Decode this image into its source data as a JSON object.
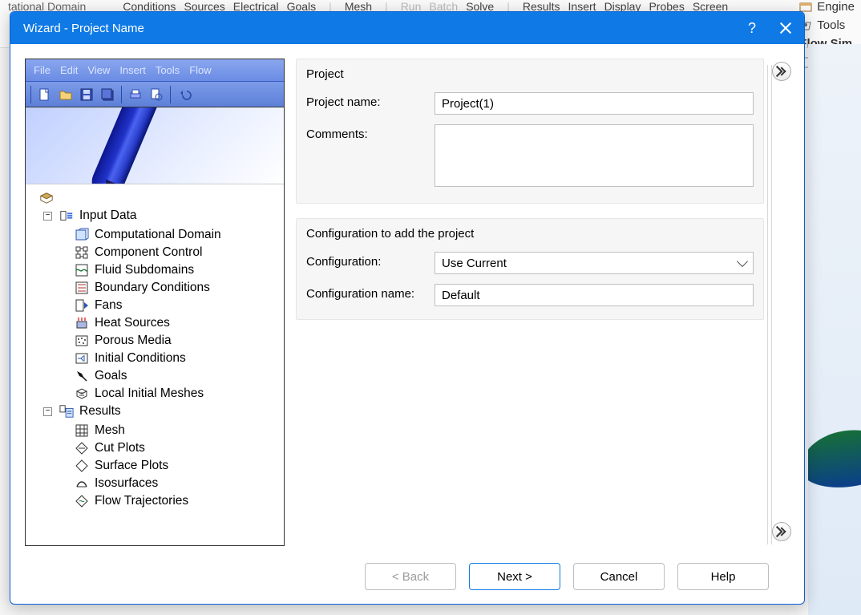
{
  "background": {
    "ribbon_items": [
      "Conditions",
      "Sources",
      "Electrical",
      "Goals",
      "Mesh",
      "Run",
      "Batch",
      "Solve",
      "Results",
      "Insert",
      "Display",
      "Probes",
      "Screen"
    ],
    "left_cut_text": "tational Domain",
    "right_items": [
      "Engine",
      "Tools",
      "Flow Sim"
    ]
  },
  "dialog": {
    "title": "Wizard - Project Name"
  },
  "left": {
    "menus": [
      "File",
      "Edit",
      "View",
      "Insert",
      "Tools",
      "Flow"
    ],
    "root_label": "",
    "tree": {
      "input_data": "Input Data",
      "children_input": [
        "Computational Domain",
        "Component Control",
        "Fluid Subdomains",
        "Boundary Conditions",
        "Fans",
        "Heat Sources",
        "Porous Media",
        "Initial Conditions",
        "Goals",
        "Local Initial Meshes"
      ],
      "results": "Results",
      "children_results": [
        "Mesh",
        "Cut Plots",
        "Surface Plots",
        "Isosurfaces",
        "Flow Trajectories"
      ]
    }
  },
  "groups": {
    "project_legend": "Project",
    "project_name_label": "Project name:",
    "project_name_value": "Project(1)",
    "comments_label": "Comments:",
    "comments_value": "",
    "config_legend": "Configuration to add the project",
    "config_label": "Configuration:",
    "config_value": "Use Current",
    "config_name_label": "Configuration name:",
    "config_name_value": "Default"
  },
  "buttons": {
    "back": "< Back",
    "next": "Next >",
    "cancel": "Cancel",
    "help": "Help"
  }
}
